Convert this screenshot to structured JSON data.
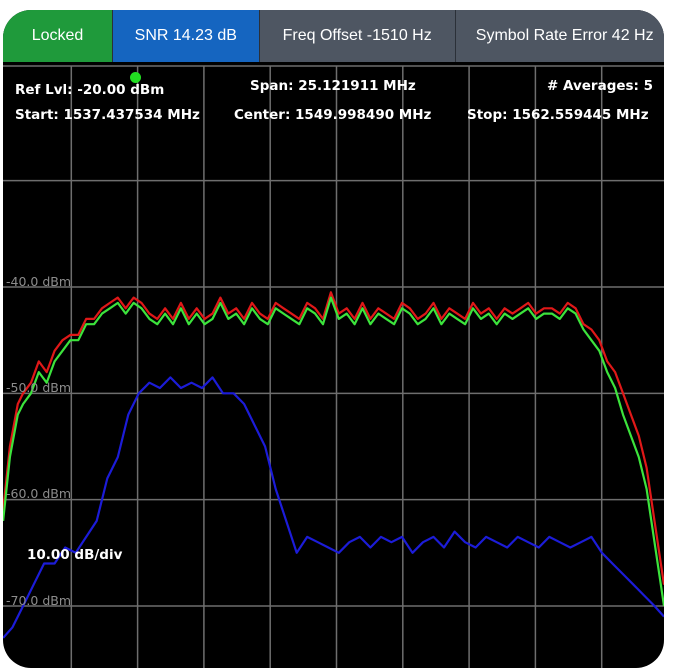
{
  "tabs": {
    "locked": "Locked",
    "snr": "SNR 14.23 dB",
    "freq_offset": "Freq Offset -1510 Hz",
    "symbol_rate": "Symbol Rate Error 42 Hz"
  },
  "info": {
    "ref_level": "Ref Lvl: -20.00 dBm",
    "span": "Span: 25.121911 MHz",
    "averages": "# Averages: 5",
    "start": "Start: 1537.437534 MHz",
    "center": "Center: 1549.998490 MHz",
    "stop": "Stop: 1562.559445 MHz",
    "scale": "10.00 dB/div"
  },
  "y_labels": [
    "-40.0 dBm",
    "-50.0 dBm",
    "-60.0 dBm",
    "-70.0 dBm"
  ],
  "colors": {
    "locked": "#1f9a3b",
    "snr": "#1565c0",
    "tab": "#4e5662",
    "background": "#000000",
    "grid": "#6e6e6e",
    "trace_max": "#e01818",
    "trace_avg": "#3ce33c",
    "trace_min": "#1c1cd8",
    "ref_marker": "#22e022"
  },
  "chart_data": {
    "type": "line",
    "xlabel": "",
    "ylabel": "",
    "xlim": [
      1537.437534,
      1562.559445
    ],
    "ylim": [
      -74,
      -28
    ],
    "series": [
      {
        "color": "#e01818",
        "x": [
          1537.44,
          1537.7,
          1538.0,
          1538.2,
          1538.5,
          1538.8,
          1539.1,
          1539.4,
          1539.7,
          1540.0,
          1540.3,
          1540.6,
          1540.9,
          1541.2,
          1541.5,
          1541.8,
          1542.1,
          1542.4,
          1542.7,
          1543.0,
          1543.3,
          1543.6,
          1543.9,
          1544.2,
          1544.5,
          1544.8,
          1545.1,
          1545.4,
          1545.7,
          1546.0,
          1546.3,
          1546.6,
          1546.9,
          1547.2,
          1547.5,
          1547.8,
          1548.1,
          1548.4,
          1548.7,
          1549.0,
          1549.3,
          1549.6,
          1549.9,
          1550.2,
          1550.5,
          1550.8,
          1551.1,
          1551.4,
          1551.7,
          1552.0,
          1552.3,
          1552.6,
          1552.9,
          1553.2,
          1553.5,
          1553.8,
          1554.1,
          1554.4,
          1554.7,
          1555.0,
          1555.3,
          1555.6,
          1555.9,
          1556.2,
          1556.5,
          1556.8,
          1557.1,
          1557.4,
          1557.7,
          1558.0,
          1558.3,
          1558.6,
          1558.9,
          1559.2,
          1559.5,
          1559.8,
          1560.1,
          1560.4,
          1560.7,
          1561.0,
          1561.3,
          1561.6,
          1561.9,
          1562.2,
          1562.56
        ],
        "values": [
          -61,
          -55,
          -51,
          -50,
          -49,
          -47,
          -48,
          -46,
          -45,
          -44.5,
          -44.5,
          -43,
          -43,
          -42,
          -41.5,
          -41,
          -42,
          -41,
          -41.5,
          -42.5,
          -43,
          -42,
          -43,
          -41.5,
          -43,
          -42,
          -43,
          -42.5,
          -41,
          -42.5,
          -42,
          -43,
          -41.5,
          -42.5,
          -43,
          -41.5,
          -42,
          -42.5,
          -43,
          -41.5,
          -42,
          -43,
          -40.5,
          -42.5,
          -42,
          -43,
          -41.5,
          -43,
          -42,
          -42.5,
          -43,
          -41.5,
          -42,
          -43,
          -42.5,
          -41.5,
          -43,
          -42,
          -42.5,
          -43,
          -41.5,
          -42.5,
          -42,
          -43,
          -42,
          -42.5,
          -42,
          -41.5,
          -42.5,
          -42,
          -42,
          -42.5,
          -41.5,
          -42,
          -43.5,
          -44,
          -45,
          -47,
          -48,
          -50,
          -52,
          -54,
          -57,
          -62,
          -68
        ]
      },
      {
        "color": "#3ce33c",
        "x": [
          1537.44,
          1537.7,
          1538.0,
          1538.2,
          1538.5,
          1538.8,
          1539.1,
          1539.4,
          1539.7,
          1540.0,
          1540.3,
          1540.6,
          1540.9,
          1541.2,
          1541.5,
          1541.8,
          1542.1,
          1542.4,
          1542.7,
          1543.0,
          1543.3,
          1543.6,
          1543.9,
          1544.2,
          1544.5,
          1544.8,
          1545.1,
          1545.4,
          1545.7,
          1546.0,
          1546.3,
          1546.6,
          1546.9,
          1547.2,
          1547.5,
          1547.8,
          1548.1,
          1548.4,
          1548.7,
          1549.0,
          1549.3,
          1549.6,
          1549.9,
          1550.2,
          1550.5,
          1550.8,
          1551.1,
          1551.4,
          1551.7,
          1552.0,
          1552.3,
          1552.6,
          1552.9,
          1553.2,
          1553.5,
          1553.8,
          1554.1,
          1554.4,
          1554.7,
          1555.0,
          1555.3,
          1555.6,
          1555.9,
          1556.2,
          1556.5,
          1556.8,
          1557.1,
          1557.4,
          1557.7,
          1558.0,
          1558.3,
          1558.6,
          1558.9,
          1559.2,
          1559.5,
          1559.8,
          1560.1,
          1560.4,
          1560.7,
          1561.0,
          1561.3,
          1561.6,
          1561.9,
          1562.2,
          1562.56
        ],
        "values": [
          -62,
          -56,
          -52,
          -51,
          -50,
          -48,
          -49,
          -47,
          -46,
          -45,
          -45,
          -43.5,
          -43.5,
          -42.5,
          -42,
          -41.5,
          -42.5,
          -41.5,
          -42,
          -43,
          -43.5,
          -42.5,
          -43.5,
          -42,
          -43.5,
          -42.5,
          -43.5,
          -43,
          -41.5,
          -43,
          -42.5,
          -43.5,
          -42,
          -43,
          -43.5,
          -42,
          -42.5,
          -43,
          -43.5,
          -42,
          -42.5,
          -43.5,
          -41,
          -43,
          -42.5,
          -43.5,
          -42,
          -43.5,
          -42.5,
          -43,
          -43.5,
          -42,
          -42.5,
          -43.5,
          -43,
          -42,
          -43.5,
          -42.5,
          -43,
          -43.5,
          -42,
          -43,
          -42.5,
          -43.5,
          -42.5,
          -43,
          -42.5,
          -42,
          -43,
          -42.5,
          -42.5,
          -43,
          -42,
          -42.5,
          -44,
          -45,
          -46,
          -48,
          -49.5,
          -52,
          -54,
          -56,
          -59,
          -64,
          -70
        ]
      },
      {
        "color": "#1c1cd8",
        "x": [
          1537.44,
          1537.8,
          1538.2,
          1538.6,
          1539.0,
          1539.4,
          1539.8,
          1540.2,
          1540.6,
          1541.0,
          1541.4,
          1541.8,
          1542.2,
          1542.6,
          1543.0,
          1543.4,
          1543.8,
          1544.2,
          1544.6,
          1545.0,
          1545.4,
          1545.8,
          1546.2,
          1546.6,
          1547.0,
          1547.4,
          1547.8,
          1548.2,
          1548.6,
          1549.0,
          1549.4,
          1549.8,
          1550.2,
          1550.6,
          1551.0,
          1551.4,
          1551.8,
          1552.2,
          1552.6,
          1553.0,
          1553.4,
          1553.8,
          1554.2,
          1554.6,
          1555.0,
          1555.4,
          1555.8,
          1556.2,
          1556.6,
          1557.0,
          1557.4,
          1557.8,
          1558.2,
          1558.6,
          1559.0,
          1559.4,
          1559.8,
          1560.2,
          1560.6,
          1561.0,
          1561.4,
          1561.8,
          1562.2,
          1562.56
        ],
        "values": [
          -73,
          -72,
          -70,
          -68,
          -66,
          -66,
          -64.5,
          -65,
          -63.5,
          -62,
          -58,
          -56,
          -52,
          -50,
          -49,
          -49.5,
          -48.5,
          -49.5,
          -49,
          -49.5,
          -48.5,
          -50,
          -50,
          -51,
          -53,
          -55,
          -59,
          -62,
          -65,
          -63.5,
          -64,
          -64.5,
          -65,
          -64,
          -63.5,
          -64.5,
          -63.5,
          -64,
          -63.5,
          -65,
          -64,
          -63.5,
          -64.5,
          -63,
          -64,
          -64.5,
          -63.5,
          -64,
          -64.5,
          -63.5,
          -64,
          -64.5,
          -63.5,
          -64,
          -64.5,
          -64,
          -63.5,
          -65,
          -66,
          -67,
          -68,
          -69,
          -70,
          -71
        ]
      }
    ]
  }
}
